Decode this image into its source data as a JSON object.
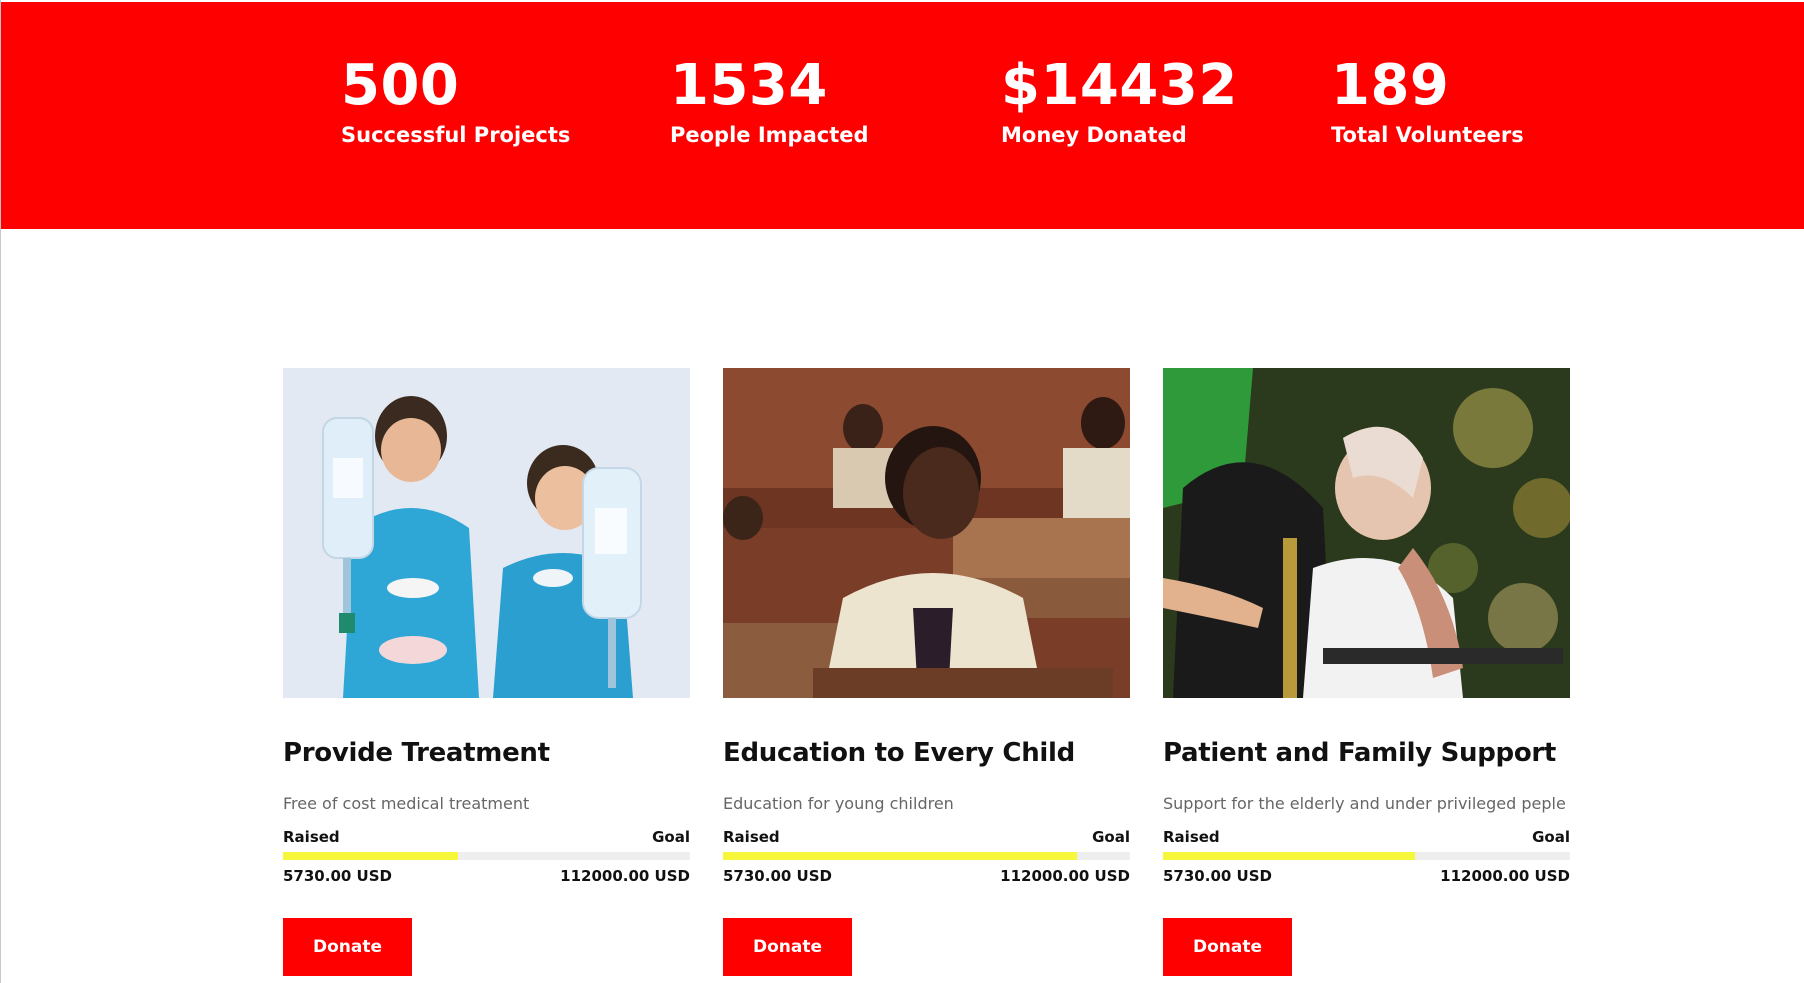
{
  "stats": [
    {
      "value": "500",
      "label": "Successful Projects"
    },
    {
      "value": "1534",
      "label": "People Impacted"
    },
    {
      "value": "$14432",
      "label": "Money Donated"
    },
    {
      "value": "189",
      "label": "Total Volunteers"
    }
  ],
  "causes": [
    {
      "title": "Provide Treatment",
      "description": "Free of cost medical treatment",
      "raised_label": "Raised",
      "goal_label": "Goal",
      "raised_amount": "5730.00 USD",
      "goal_amount": "112000.00 USD",
      "progress_fraction": 0.43,
      "donate_label": "Donate",
      "image_icon": "children-iv-bags-photo"
    },
    {
      "title": "Education to Every Child",
      "description": "Education for young children",
      "raised_label": "Raised",
      "goal_label": "Goal",
      "raised_amount": "5730.00 USD",
      "goal_amount": "112000.00 USD",
      "progress_fraction": 0.87,
      "donate_label": "Donate",
      "image_icon": "classroom-student-photo"
    },
    {
      "title": "Patient and Family Support",
      "description": "Support for the elderly and under privileged peple",
      "raised_label": "Raised",
      "goal_label": "Goal",
      "raised_amount": "5730.00 USD",
      "goal_amount": "112000.00 USD",
      "progress_fraction": 0.62,
      "donate_label": "Donate",
      "image_icon": "elderly-wheelchair-photo"
    }
  ],
  "colors": {
    "brand_red": "#ff0000",
    "progress_yellow": "#f6f63a",
    "track_gray": "#eeeeee"
  }
}
